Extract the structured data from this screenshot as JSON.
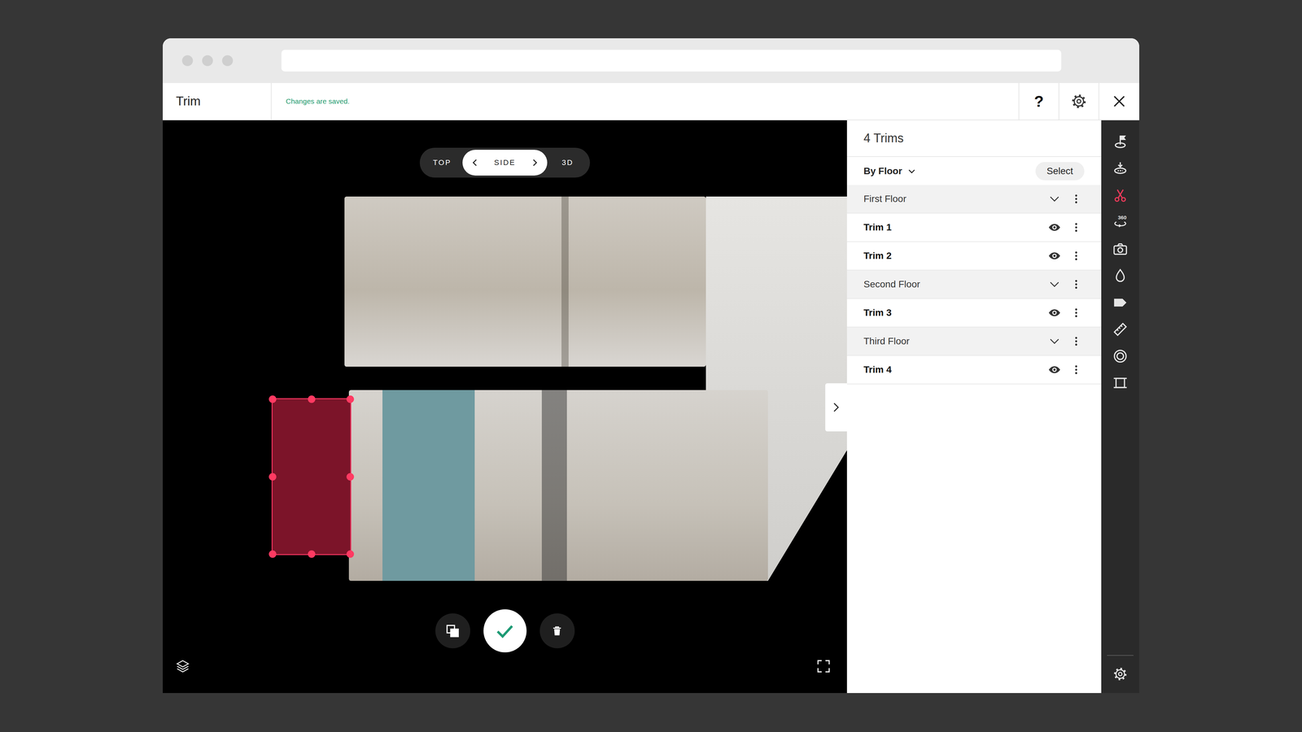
{
  "window": {
    "title": "Trim",
    "status": "Changes are saved."
  },
  "header": {
    "help": "?"
  },
  "view_modes": [
    {
      "label": "TOP",
      "selected": false
    },
    {
      "label": "SIDE",
      "selected": true
    },
    {
      "label": "3D",
      "selected": false
    }
  ],
  "canvas": {
    "trim_editing": true
  },
  "panel": {
    "title": "4 Trims",
    "grouping": "By Floor",
    "select_button": "Select"
  },
  "floors": [
    {
      "name": "First Floor",
      "expanded": true,
      "trims": [
        {
          "name": "Trim 1",
          "visible": true
        },
        {
          "name": "Trim 2",
          "visible": true
        }
      ]
    },
    {
      "name": "Second Floor",
      "expanded": true,
      "trims": [
        {
          "name": "Trim 3",
          "visible": true
        }
      ]
    },
    {
      "name": "Third Floor",
      "expanded": true,
      "trims": [
        {
          "name": "Trim 4",
          "visible": true
        }
      ]
    }
  ],
  "tools": [
    {
      "kind": "start",
      "selected": false
    },
    {
      "kind": "floor",
      "selected": false
    },
    {
      "kind": "trim",
      "selected": true
    },
    {
      "kind": "pano",
      "selected": false,
      "badge": "360"
    },
    {
      "kind": "photo",
      "selected": false
    },
    {
      "kind": "color",
      "selected": false
    },
    {
      "kind": "tag",
      "selected": false
    },
    {
      "kind": "measure",
      "selected": false
    },
    {
      "kind": "focus",
      "selected": false
    },
    {
      "kind": "video",
      "selected": false
    }
  ]
}
